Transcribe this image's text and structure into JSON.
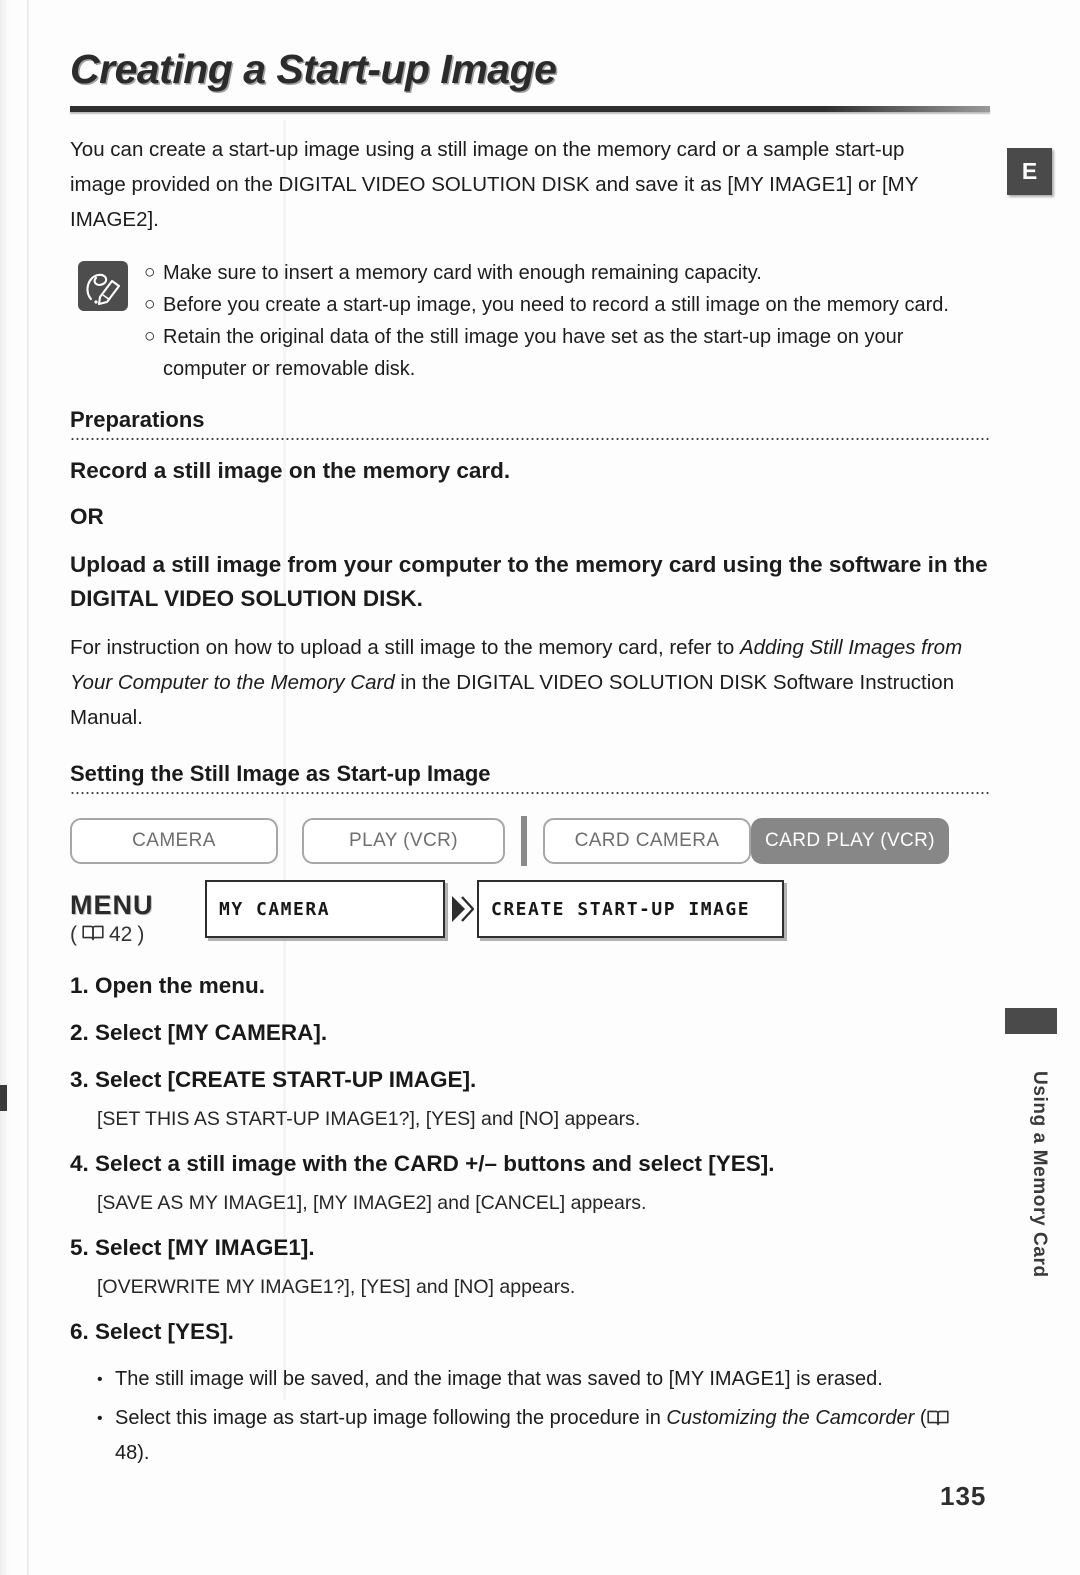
{
  "page": {
    "title": "Creating a Start-up Image",
    "number": "135",
    "language_tab": "E",
    "side_label": "Using a Memory Card"
  },
  "intro": "You can create a start-up image using a still image on the memory card or a sample start-up image provided on the DIGITAL VIDEO SOLUTION DISK and save it as [MY IMAGE1] or [MY IMAGE2].",
  "notes": {
    "bullet": "○",
    "items": [
      "Make sure to insert a memory card with enough remaining capacity.",
      "Before you create a start-up image, you need to record a still image on the memory card.",
      "Retain the original data of the still image you have set as the start-up image on your computer or removable disk."
    ]
  },
  "preparations": {
    "heading": "Preparations",
    "line1": "Record a still image on the memory card.",
    "or": "OR",
    "line2": "Upload a still image from your computer to the memory card using the software in the DIGITAL VIDEO SOLUTION DISK.",
    "para_part1": "For instruction on how to upload a still image to the memory card, refer to ",
    "para_italic": "Adding Still Images from Your Computer to the Memory Card",
    "para_part2": " in the DIGITAL VIDEO SOLUTION DISK Software Instruction Manual."
  },
  "setting": {
    "heading": "Setting the Still Image as Start-up Image",
    "modes": [
      {
        "label": "CAMERA",
        "active": false
      },
      {
        "label": "PLAY (VCR)",
        "active": false
      },
      {
        "label": "CARD CAMERA",
        "active": false
      },
      {
        "label": "CARD PLAY (VCR)",
        "active": true
      }
    ],
    "menu": {
      "label": "MENU",
      "ref_open": "(",
      "ref_page": "42",
      "ref_close": ")",
      "box1": "MY CAMERA",
      "box2": "CREATE START-UP IMAGE",
      "arrow": "double-chevron-right"
    }
  },
  "steps": [
    {
      "title": "1. Open the menu.",
      "note": null
    },
    {
      "title": "2. Select [MY CAMERA].",
      "note": null
    },
    {
      "title": "3. Select [CREATE START-UP IMAGE].",
      "note": "[SET THIS AS START-UP IMAGE1?], [YES] and [NO] appears."
    },
    {
      "title": "4. Select a still image with the CARD +/– buttons and select [YES].",
      "note": "[SAVE AS MY IMAGE1], [MY IMAGE2] and [CANCEL] appears."
    },
    {
      "title": "5. Select [MY IMAGE1].",
      "note": "[OVERWRITE MY IMAGE1?], [YES] and [NO] appears."
    },
    {
      "title": "6. Select [YES].",
      "note": null
    }
  ],
  "final_bullets": {
    "dot": "•",
    "item1": "The still image will be saved, and the image that was saved to [MY IMAGE1] is erased.",
    "item2_part1": "Select this image as start-up image following the procedure in ",
    "item2_italic": "Customizing the Camcorder",
    "item2_open": " (",
    "item2_page": "48",
    "item2_close": ")."
  }
}
